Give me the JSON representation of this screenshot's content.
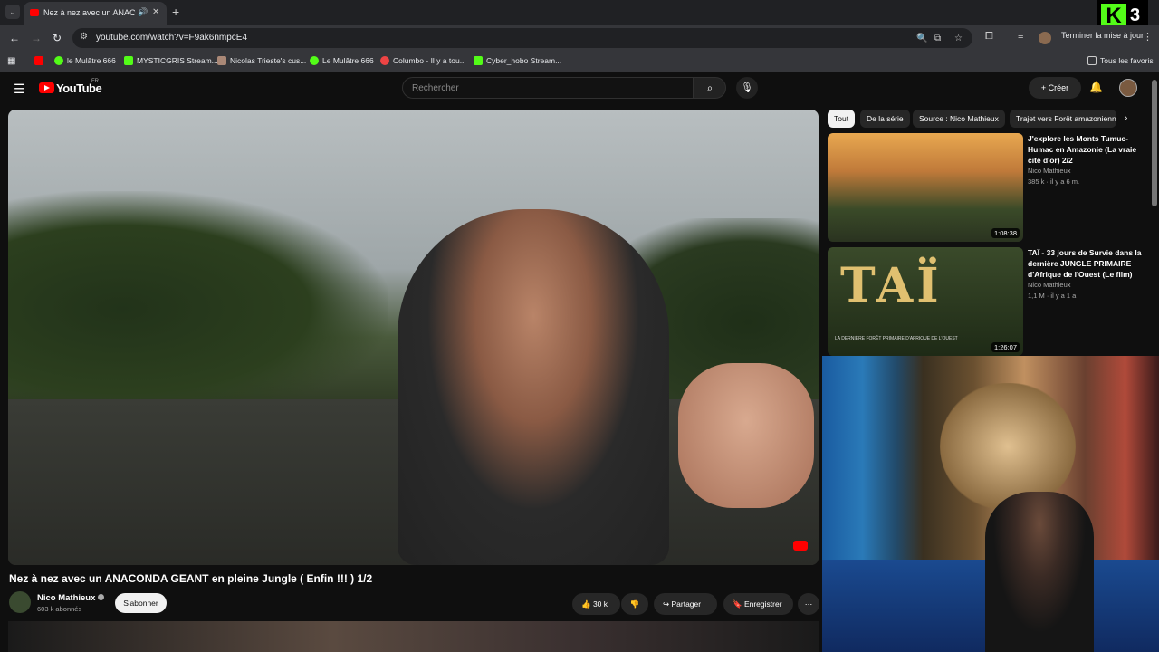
{
  "browser": {
    "tab_title": "Nez à nez avec un ANACONDA GEANT en pleine Jungle",
    "url": "youtube.com/watch?v=F9ak6nmpcE4",
    "update_label": "Terminer la mise à jour",
    "bookmarks": [
      "le Mulâtre 666",
      "MYSTICGRIS Stream...",
      "Nicolas Trieste's cus...",
      "Le Mulâtre 666",
      "Columbo - Il y a tou...",
      "Cyber_hobo Stream..."
    ],
    "all_bookmarks_label": "Tous les favoris"
  },
  "overlay": {
    "badge_letter": "K",
    "badge_number": "3"
  },
  "youtube": {
    "logo": "YouTube",
    "region": "FR",
    "search_placeholder": "Rechercher",
    "create_label": "Créer"
  },
  "video": {
    "title": "Nez à nez avec un ANACONDA GEANT en pleine Jungle ( Enfin !!! ) 1/2",
    "channel": "Nico Mathieux",
    "subscribers": "603 k abonnés",
    "subscribe_label": "S'abonner",
    "likes": "30 k",
    "share_label": "Partager",
    "save_label": "Enregistrer"
  },
  "chips": [
    "Tout",
    "De la série",
    "Source : Nico Mathieux",
    "Trajet vers Forêt amazonienne"
  ],
  "recommendations": [
    {
      "title": "J'explore les Monts Tumuc-Humac en Amazonie (La vraie cité d'or) 2/2",
      "channel": "Nico Mathieux",
      "meta": "385 k · il y a 6 m.",
      "duration": "1:08:38"
    },
    {
      "title": "TAÏ - 33 jours de Survie dans la dernière JUNGLE PRIMAIRE d'Afrique de l'Ouest (Le film)",
      "channel": "Nico Mathieux",
      "meta": "1,1 M · il y a 1 a",
      "duration": "1:26:07",
      "thumb_text": "TAÏ",
      "thumb_sub": "LA DERNIÈRE FORÊT PRIMAIRE D'AFRIQUE DE L'OUEST"
    }
  ]
}
